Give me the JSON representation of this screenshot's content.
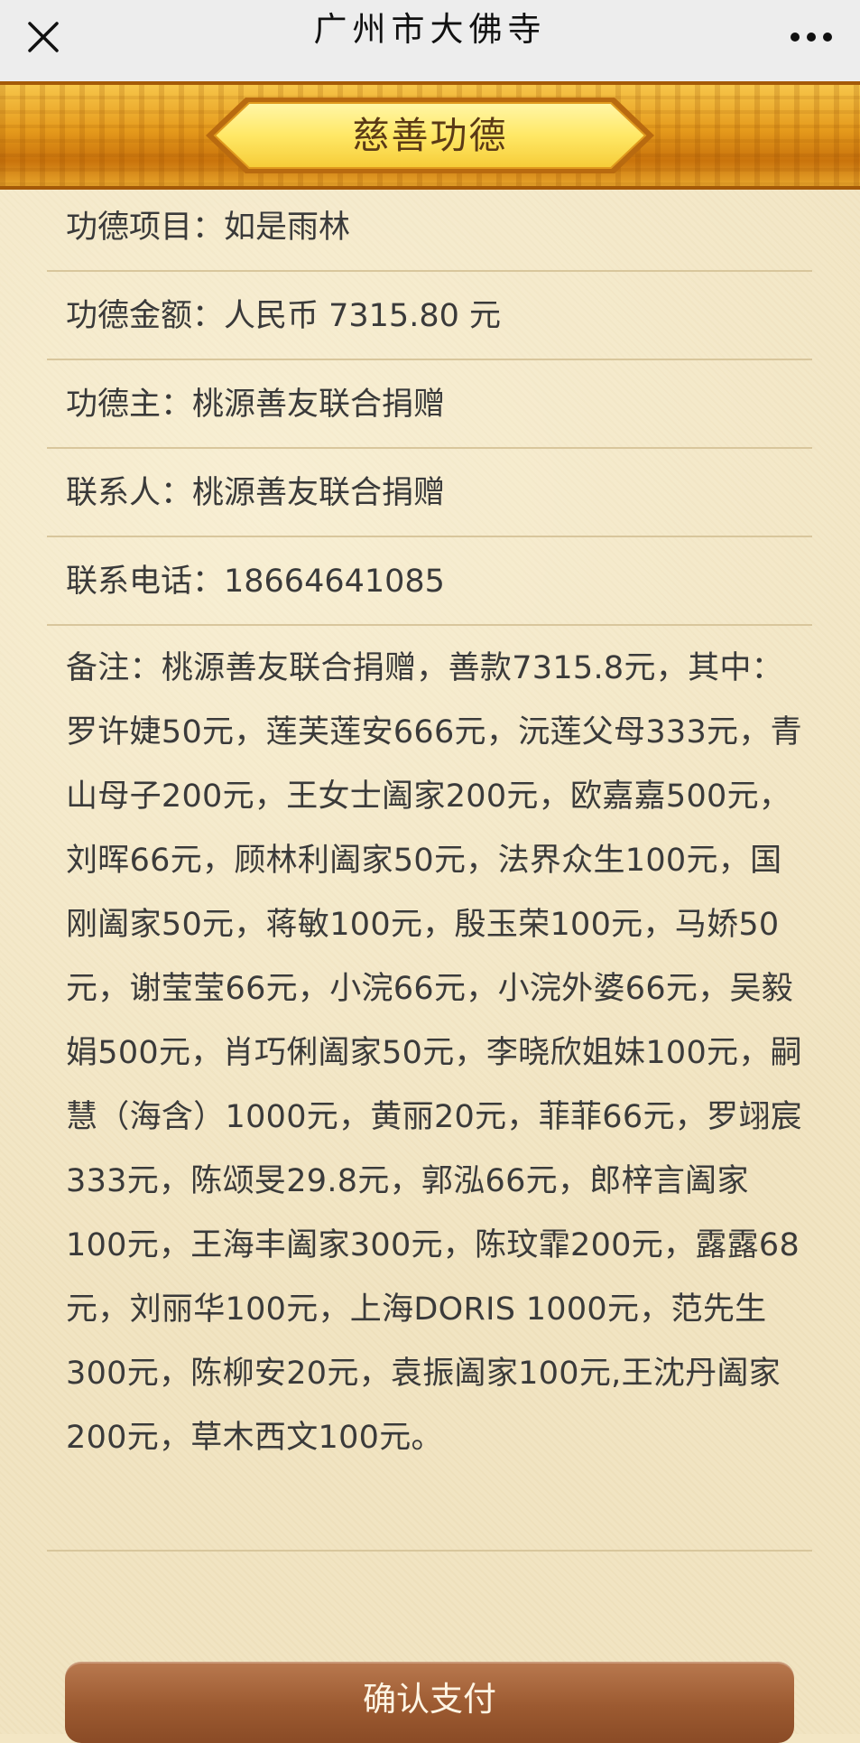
{
  "nav": {
    "title": "广州市大佛寺"
  },
  "banner": {
    "title": "慈善功德"
  },
  "details": {
    "project": "功德项目：如是雨林",
    "amount": "功德金额：人民币 7315.80 元",
    "donor": "功德主：桃源善友联合捐赠",
    "contact": "联系人：桃源善友联合捐赠",
    "phone": "联系电话：18664641085",
    "note": "备注：桃源善友联合捐赠，善款7315.8元，其中：罗许婕50元，莲芙莲安666元，沅莲父母333元，青山母子200元，王女士阖家200元，欧嘉嘉500元，刘晖66元，顾林利阖家50元，法界众生100元，国刚阖家50元，蒋敏100元，殷玉荣100元，马娇50元，谢莹莹66元，小浣66元，小浣外婆66元，吴毅娟500元，肖巧俐阖家50元，李晓欣姐妹100元，嗣慧（海含）1000元，黄丽20元，菲菲66元，罗翊宸333元，陈颂旻29.8元，郭泓66元，郎梓言阖家100元，王海丰阖家300元，陈玟霏200元，露露68元，刘丽华100元，上海DORIS 1000元，范先生300元，陈柳安20元，袁振阖家100元,王沈丹阖家200元，草木西文100元。"
  },
  "actions": {
    "confirm_label": "确认支付"
  },
  "icons": {
    "close": "close-icon",
    "more": "more-icon"
  },
  "colors": {
    "banner_gold": "#f0b132",
    "button_brown": "#9c5a31",
    "page_parchment": "#f1e4c2"
  }
}
